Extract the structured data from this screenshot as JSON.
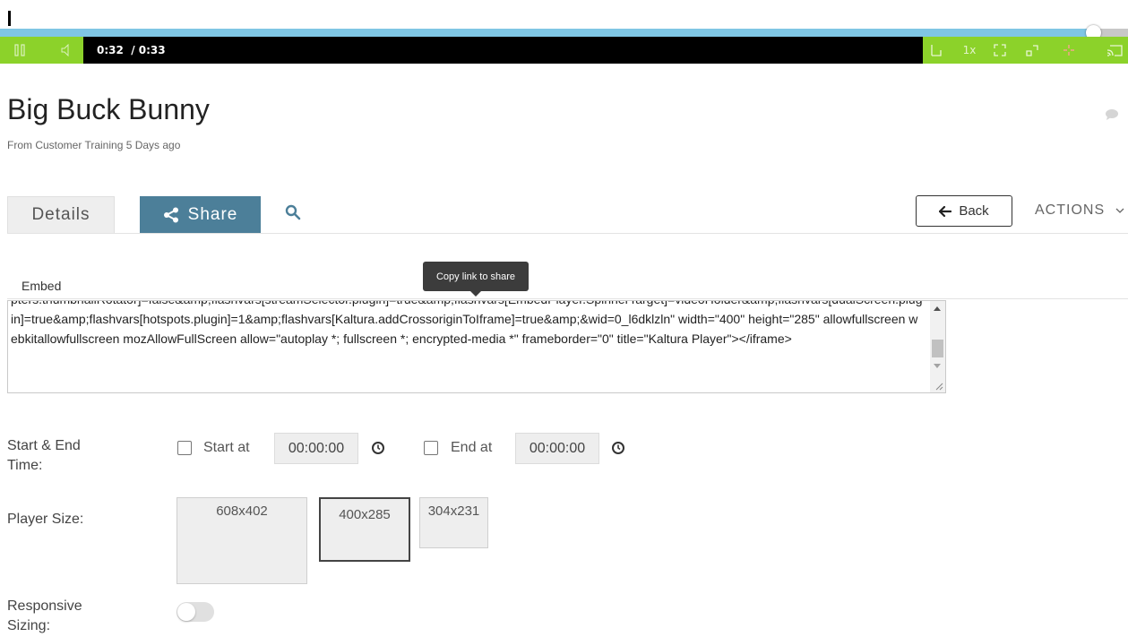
{
  "player": {
    "progress_fraction": 0.969,
    "current_time": "0:32",
    "duration": "/ 0:33",
    "speed_label": "1x",
    "colors": {
      "accent": "#8cd22a",
      "progress": "#7fc6e4",
      "bar": "#000000"
    }
  },
  "entry": {
    "title": "Big Buck Bunny",
    "subtitle": "From Customer Training 5 Days ago"
  },
  "tabs": {
    "details_label": "Details",
    "share_label": "Share",
    "back_label": "Back",
    "actions_label": "ACTIONS"
  },
  "embed": {
    "label": "Embed",
    "tooltip": "Copy link to share",
    "code": "pters.thumbnailRotator]=false&amp;flashvars[streamSelector.plugin]=true&amp;flashvars[EmbedPlayer.SpinnerTarget]=videoHolder&amp;flashvars[dualScreen.plugin]=true&amp;flashvars[hotspots.plugin]=1&amp;flashvars[Kaltura.addCrossoriginToIframe]=true&amp;&wid=0_l6dklzln\" width=\"400\" height=\"285\" allowfullscreen webkitallowfullscreen mozAllowFullScreen allow=\"autoplay *; fullscreen *; encrypted-media *\" frameborder=\"0\" title=\"Kaltura Player\"></iframe>"
  },
  "timing": {
    "row_label_1": "Start &amp; End",
    "row_label_2": "Time:",
    "start_label": "Start at",
    "start_value": "00:00:00",
    "end_label": "End at",
    "end_value": "00:00:00"
  },
  "player_size": {
    "label": "Player Size:",
    "options": [
      "608x402",
      "400x285",
      "304x231"
    ],
    "selected": "400x285"
  },
  "responsive": {
    "label_1": "Responsive",
    "label_2": "Sizing:",
    "enabled": false
  }
}
